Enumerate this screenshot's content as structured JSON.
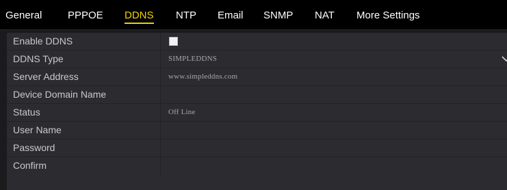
{
  "tabs": [
    {
      "label": "General",
      "active": false
    },
    {
      "label": "PPPOE",
      "active": false
    },
    {
      "label": "DDNS",
      "active": true
    },
    {
      "label": "NTP",
      "active": false
    },
    {
      "label": "Email",
      "active": false
    },
    {
      "label": "SNMP",
      "active": false
    },
    {
      "label": "NAT",
      "active": false
    },
    {
      "label": "More Settings",
      "active": false
    }
  ],
  "form": {
    "enable_ddns": {
      "label": "Enable DDNS",
      "checked": false
    },
    "ddns_type": {
      "label": "DDNS Type",
      "value": "SIMPLEDDNS"
    },
    "server_address": {
      "label": "Server Address",
      "value": "www.simpleddns.com"
    },
    "device_domain_name": {
      "label": "Device Domain Name",
      "value": ""
    },
    "status": {
      "label": "Status",
      "value": "Off Line"
    },
    "user_name": {
      "label": "User Name",
      "value": ""
    },
    "password": {
      "label": "Password",
      "value": ""
    },
    "confirm": {
      "label": "Confirm",
      "value": ""
    }
  },
  "colors": {
    "active_tab": "#f2d200",
    "tab_bar": "#000000",
    "panel": "#2c2c30",
    "label_text": "#c9c9c9"
  }
}
